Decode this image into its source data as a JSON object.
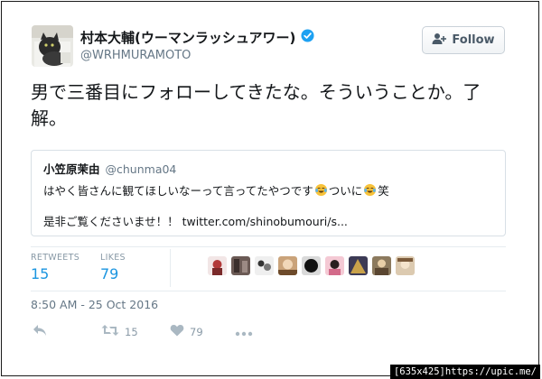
{
  "author": {
    "display_name": "村本大輔(ウーマンラッシュアワー)",
    "handle": "@WRHMURAMOTO",
    "verified_icon": "verified-badge-icon",
    "avatar_icon": "cat-avatar"
  },
  "follow_button": {
    "label": "Follow",
    "icon": "add-user-icon"
  },
  "tweet": {
    "text": "男で三番目にフォローしてきたな。そういうことか。了解。"
  },
  "quoted_tweet": {
    "name": "小笠原茉由",
    "handle": "@chunma04",
    "line1_a": "はやく皆さんに観てほしいなーって言ってたやつです",
    "line1_b": "ついに",
    "line1_c": "笑",
    "line2_prefix": "是非ご覧くださいませ！！ ",
    "link": "twitter.com/shinobumouri/s..."
  },
  "stats": {
    "retweets_label": "RETWEETS",
    "retweets_value": "15",
    "likes_label": "LIKES",
    "likes_value": "79"
  },
  "timestamp": "8:50 AM - 25 Oct 2016",
  "actions": {
    "retweet_count": "15",
    "like_count": "79"
  },
  "watermark": "[635x425]https://upic.me/"
}
